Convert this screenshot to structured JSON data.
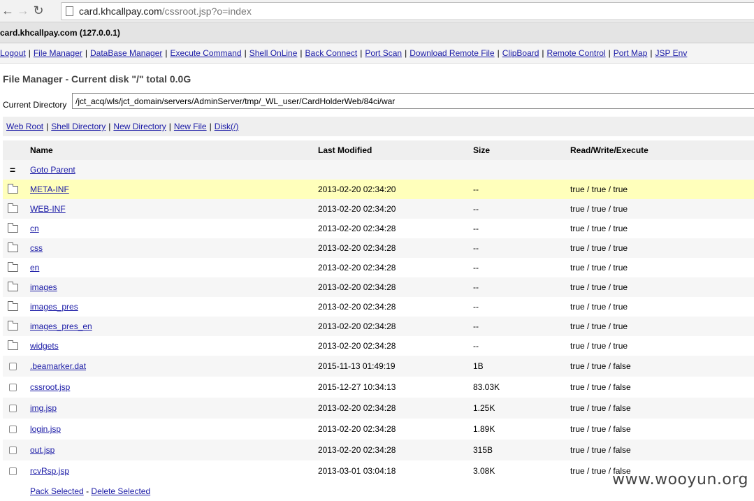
{
  "browser": {
    "url_host": "card.khcallpay.com",
    "url_path": "/cssroot.jsp?o=index"
  },
  "host_label": "card.khcallpay.com (127.0.0.1)",
  "menu": [
    "Logout",
    "File Manager",
    "DataBase Manager",
    "Execute Command",
    "Shell OnLine",
    "Back Connect",
    "Port Scan",
    "Download Remote File",
    "ClipBoard",
    "Remote Control",
    "Port Map",
    "JSP Env"
  ],
  "fm_title": "File Manager - Current disk \"/\" total 0.0G",
  "current_dir_label": "Current Directory",
  "current_dir_value": "/jct_acq/wls/jct_domain/servers/AdminServer/tmp/_WL_user/CardHolderWeb/84ci/war",
  "quick_links": [
    "Web Root",
    "Shell Directory",
    "New Directory",
    "New File",
    "Disk(/)"
  ],
  "table": {
    "headers": {
      "name": "Name",
      "modified": "Last Modified",
      "size": "Size",
      "rwx": "Read/Write/Execute"
    },
    "parent_glyph": "=",
    "parent_label": "Goto Parent",
    "rows": [
      {
        "name": "META-INF",
        "modified": "2013-02-20 02:34:20",
        "size": "--",
        "rwx": "true / true / true"
      },
      {
        "name": "WEB-INF",
        "modified": "2013-02-20 02:34:20",
        "size": "--",
        "rwx": "true / true / true"
      },
      {
        "name": "cn",
        "modified": "2013-02-20 02:34:28",
        "size": "--",
        "rwx": "true / true / true"
      },
      {
        "name": "css",
        "modified": "2013-02-20 02:34:28",
        "size": "--",
        "rwx": "true / true / true"
      },
      {
        "name": "en",
        "modified": "2013-02-20 02:34:28",
        "size": "--",
        "rwx": "true / true / true"
      },
      {
        "name": "images",
        "modified": "2013-02-20 02:34:28",
        "size": "--",
        "rwx": "true / true / true"
      },
      {
        "name": "images_pres",
        "modified": "2013-02-20 02:34:28",
        "size": "--",
        "rwx": "true / true / true"
      },
      {
        "name": "images_pres_en",
        "modified": "2013-02-20 02:34:28",
        "size": "--",
        "rwx": "true / true / true"
      },
      {
        "name": "widgets",
        "modified": "2013-02-20 02:34:28",
        "size": "--",
        "rwx": "true / true / true"
      },
      {
        "name": ".beamarker.dat",
        "modified": "2015-11-13 01:49:19",
        "size": "1B",
        "rwx": "true / true / false"
      },
      {
        "name": "cssroot.jsp",
        "modified": "2015-12-27 10:34:13",
        "size": "83.03K",
        "rwx": "true / true / false"
      },
      {
        "name": "img.jsp",
        "modified": "2013-02-20 02:34:28",
        "size": "1.25K",
        "rwx": "true / true / false"
      },
      {
        "name": "login.jsp",
        "modified": "2013-02-20 02:34:28",
        "size": "1.89K",
        "rwx": "true / true / false"
      },
      {
        "name": "out.jsp",
        "modified": "2013-02-20 02:34:28",
        "size": "315B",
        "rwx": "true / true / false"
      },
      {
        "name": "rcvRsp.jsp",
        "modified": "2013-03-01 03:04:18",
        "size": "3.08K",
        "rwx": "true / true / false"
      }
    ]
  },
  "footer": {
    "pack": "Pack Selected",
    "sep": "-",
    "delete": "Delete Selected"
  },
  "watermark": "www.wooyun.org"
}
